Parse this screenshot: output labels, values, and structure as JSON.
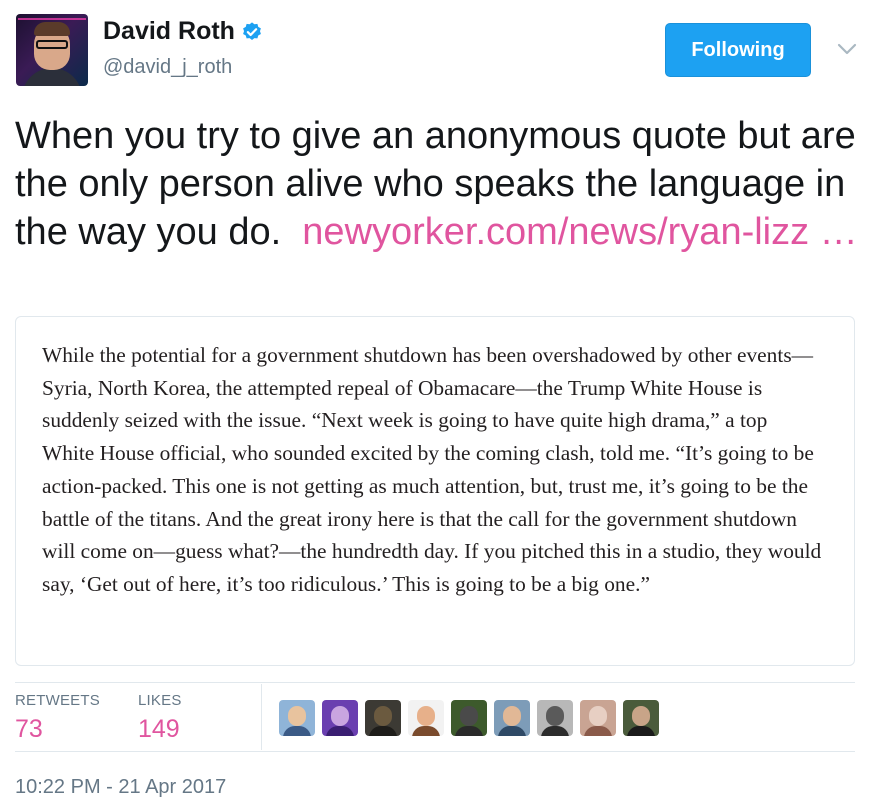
{
  "author": {
    "name": "David Roth",
    "handle": "@david_j_roth",
    "verified": true
  },
  "follow_button": {
    "label": "Following"
  },
  "tweet": {
    "text": "When you try to give an anonymous quote but are the only person alive who speaks the language in the way you do.",
    "link_text": "newyorker.com/news/ryan-lizz …"
  },
  "quote_image": {
    "text": "While the potential for a government shutdown has been overshadowed by other events—Syria, North Korea, the attempted repeal of Obamacare—the Trump White House is suddenly seized with the issue. “Next week is going to have quite high drama,” a top White House official, who sounded excited by the coming clash, told me. “It’s going to be action-packed. This one is not getting as much attention, but, trust me, it’s going to be the battle of the titans. And the great irony here is that the call for the government shutdown will come on—guess what?—the hundredth day. If you pitched this in a studio, they would say, ‘Get out of here, it’s too ridiculous.’ This is going to be a big one.”"
  },
  "stats": {
    "retweets": {
      "label": "RETWEETS",
      "count": "73"
    },
    "likes": {
      "label": "LIKES",
      "count": "149"
    }
  },
  "likers": [
    {
      "icon": "user-avatar-icon",
      "bg": "#8fb4d8",
      "face": "#e8c39e",
      "torso": "#3b5a86"
    },
    {
      "icon": "user-avatar-icon",
      "bg": "#6a3fb0",
      "face": "#c9a5e0",
      "torso": "#3a1e72"
    },
    {
      "icon": "user-avatar-icon",
      "bg": "#3c3a34",
      "face": "#6b5a3f",
      "torso": "#1e1d1a"
    },
    {
      "icon": "user-avatar-icon",
      "bg": "#f2f2f2",
      "face": "#e7b08a",
      "torso": "#7a4b2d"
    },
    {
      "icon": "user-avatar-icon",
      "bg": "#3d5a2c",
      "face": "#4a4a4a",
      "torso": "#2a2a2a"
    },
    {
      "icon": "user-avatar-icon",
      "bg": "#7d9cb8",
      "face": "#e1b896",
      "torso": "#2f4a66"
    },
    {
      "icon": "user-avatar-icon",
      "bg": "#b8b8b8",
      "face": "#5a5a5a",
      "torso": "#2c2c2c"
    },
    {
      "icon": "user-avatar-icon",
      "bg": "#c9a493",
      "face": "#e7cfc3",
      "torso": "#8a5a4a"
    },
    {
      "icon": "user-avatar-icon",
      "bg": "#4a5b3b",
      "face": "#c8a488",
      "torso": "#1b1b1b"
    }
  ],
  "timestamp": "10:22 PM - 21 Apr 2017",
  "colors": {
    "accent_link": "#e0559f",
    "button_blue": "#1da1f2",
    "muted_text": "#657786"
  }
}
